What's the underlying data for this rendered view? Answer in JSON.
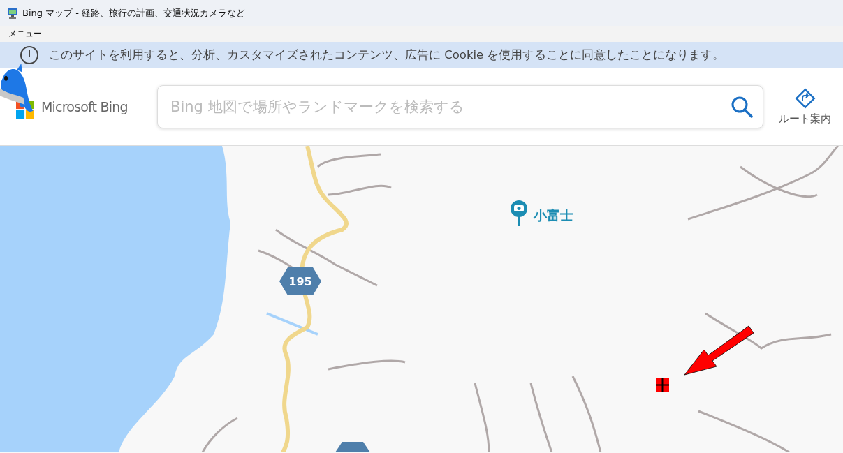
{
  "window": {
    "title": "Bing マップ - 経路、旅行の計画、交通状況カメラなど"
  },
  "menu_bar": {
    "label": "メニュー"
  },
  "cookie_banner": {
    "text": "このサイトを利用すると、分析、カスタマイズされたコンテンツ、広告に Cookie を使用することに同意したことになります。"
  },
  "header": {
    "logo_text": "Microsoft Bing",
    "search": {
      "placeholder": "Bing 地図で場所やランドマークを検索する"
    },
    "directions_button": {
      "label": "ルート案内"
    }
  },
  "map": {
    "place_label": "小富士",
    "route_shield": "195"
  }
}
